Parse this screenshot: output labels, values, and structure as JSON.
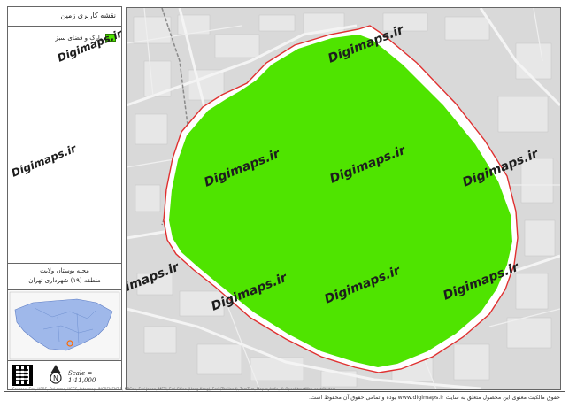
{
  "sidebar": {
    "title": "نقشه کاربری زمین",
    "legend": [
      {
        "label": "پارک و فضای سبز",
        "color": "#4fe400"
      }
    ],
    "place_name": "محله بوستان ولایت",
    "district": "منطقه (۱۹) شهرداری تهران",
    "scale": "Scale = 1:11,000",
    "north_icon": "north-arrow-icon",
    "qr_icon": "qr-code-icon"
  },
  "map": {
    "park_fill": "#4fe400",
    "boundary_color": "#e03030",
    "watermark": "Digimaps.ir"
  },
  "footer": {
    "credit": "حقوق مالکیت معنوی این محصول متعلق به سایت www.digimaps.ir بوده و تمامی حقوق آن محفوظ است.",
    "sources": "Sources: Esri, HERE, DeLorme, USGS, Intermap, INCREMENT P, NRCan, Esri Japan, METI, Esri China (Hong Kong), Esri (Thailand), TomTom, MapmyIndia, © OpenStreetMap contributors"
  }
}
